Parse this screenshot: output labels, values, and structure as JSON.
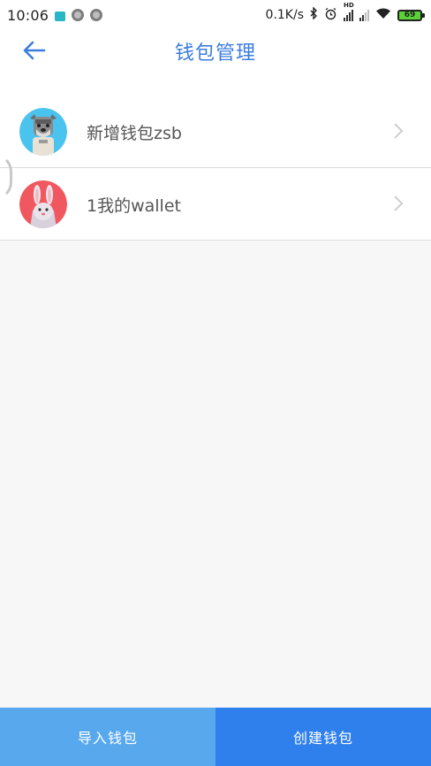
{
  "status_bar": {
    "time": "10:06",
    "net_speed": "0.1K/s",
    "battery": "69",
    "network_label": "HD"
  },
  "header": {
    "title": "钱包管理",
    "back_icon": "arrow-left-icon"
  },
  "wallets": [
    {
      "name": "新增钱包zsb",
      "avatar_icon": "dog-avatar-icon",
      "avatar_color": "#4ac3ee"
    },
    {
      "name": "1我的wallet",
      "avatar_icon": "rabbit-avatar-icon",
      "avatar_color": "#f0575f"
    }
  ],
  "bottom_bar": {
    "import_label": "导入钱包",
    "create_label": "创建钱包"
  },
  "colors": {
    "accent": "#3b7ddd",
    "import_button": "#58a8ee",
    "create_button": "#2f80ed"
  }
}
